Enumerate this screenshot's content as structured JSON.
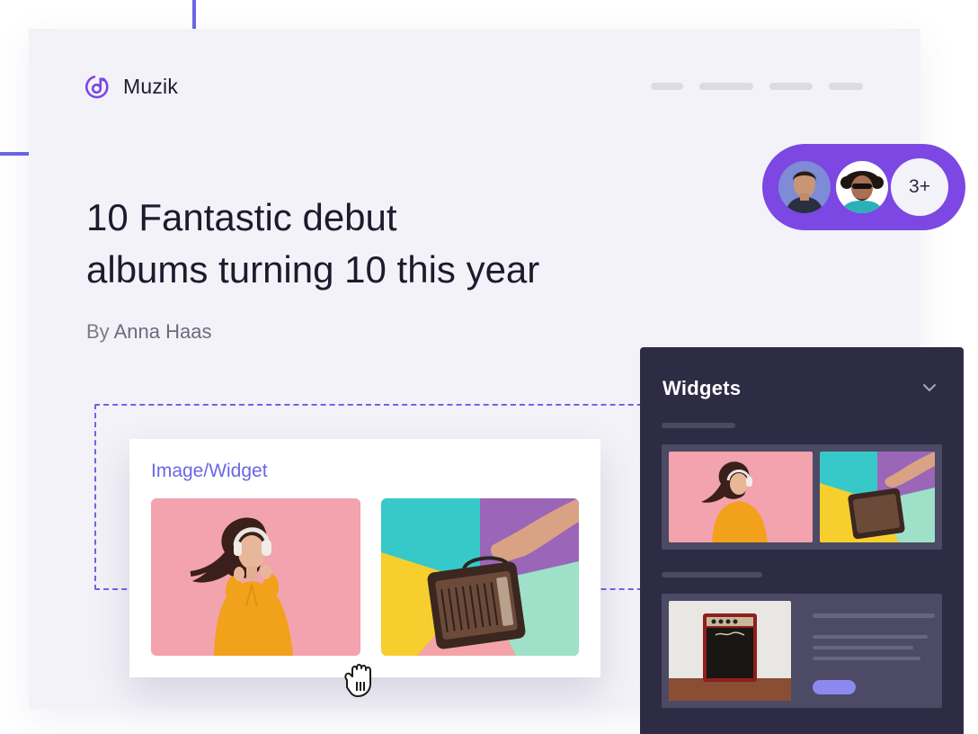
{
  "brand": {
    "name": "Muzik",
    "icon": "music-note-icon",
    "accent": "#6a67e6"
  },
  "nav": {
    "items": [
      "",
      "",
      "",
      ""
    ]
  },
  "article": {
    "headline_line1": "10 Fantastic debut",
    "headline_line2": "albums turning 10 this year",
    "byline_prefix": "By",
    "author": "Anna Haas"
  },
  "widget_card": {
    "title": "Image/Widget",
    "images": [
      "woman-with-headphones",
      "hand-holding-radio"
    ]
  },
  "collaborators": {
    "avatars": [
      "woman-avatar",
      "man-with-sunglasses-avatar"
    ],
    "more_label": "3+",
    "pill_color": "#7c47e2"
  },
  "widgets_panel": {
    "title": "Widgets",
    "icon": "chevron-down-icon",
    "thumbnails": [
      "woman-with-headphones",
      "hand-holding-radio"
    ],
    "article_preview_image": "marshall-amp",
    "background": "#2e2c44"
  },
  "cursor": "grab-hand-icon"
}
